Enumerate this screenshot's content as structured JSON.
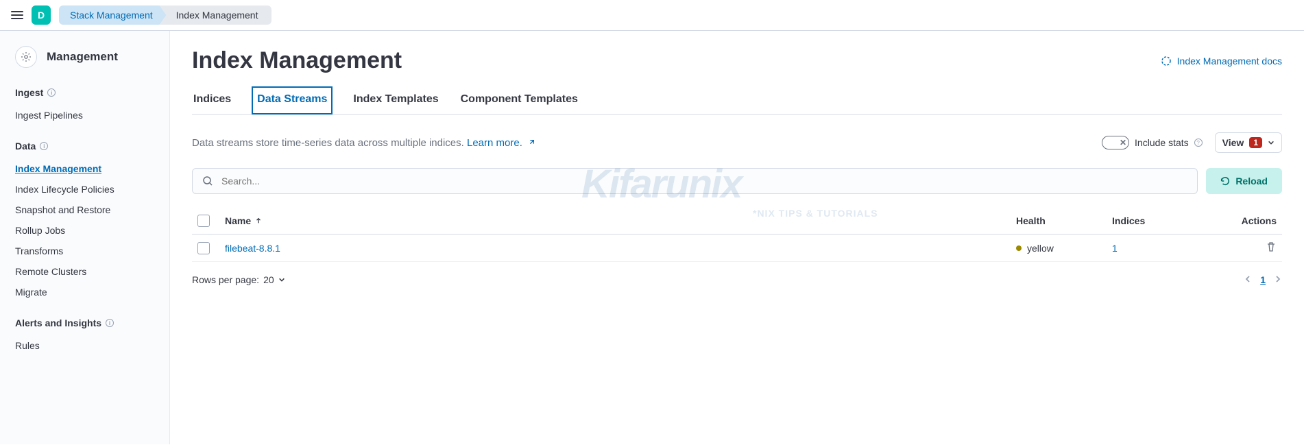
{
  "header": {
    "account_letter": "D",
    "breadcrumbs": [
      {
        "label": "Stack Management"
      },
      {
        "label": "Index Management"
      }
    ]
  },
  "sidebar": {
    "title": "Management",
    "sections": [
      {
        "title": "Ingest",
        "items": [
          {
            "label": "Ingest Pipelines",
            "active": false
          }
        ]
      },
      {
        "title": "Data",
        "items": [
          {
            "label": "Index Management",
            "active": true
          },
          {
            "label": "Index Lifecycle Policies",
            "active": false
          },
          {
            "label": "Snapshot and Restore",
            "active": false
          },
          {
            "label": "Rollup Jobs",
            "active": false
          },
          {
            "label": "Transforms",
            "active": false
          },
          {
            "label": "Remote Clusters",
            "active": false
          },
          {
            "label": "Migrate",
            "active": false
          }
        ]
      },
      {
        "title": "Alerts and Insights",
        "items": [
          {
            "label": "Rules",
            "active": false
          }
        ]
      }
    ]
  },
  "main": {
    "title": "Index Management",
    "docs_link": "Index Management docs",
    "tabs": [
      {
        "label": "Indices",
        "active": false
      },
      {
        "label": "Data Streams",
        "active": true
      },
      {
        "label": "Index Templates",
        "active": false
      },
      {
        "label": "Component Templates",
        "active": false
      }
    ],
    "description": "Data streams store time-series data across multiple indices.",
    "learn_more": "Learn more.",
    "include_stats_label": "Include stats",
    "view_label": "View",
    "view_badge": "1",
    "search_placeholder": "Search...",
    "reload_label": "Reload",
    "columns": {
      "name": "Name",
      "health": "Health",
      "indices": "Indices",
      "actions": "Actions"
    },
    "rows": [
      {
        "name": "filebeat-8.8.1",
        "health": "yellow",
        "indices": "1"
      }
    ],
    "rows_per_page_label": "Rows per page:",
    "rows_per_page_value": "20",
    "current_page": "1"
  },
  "watermark": {
    "text": "Kifarunix",
    "sub": "*NIX TIPS & TUTORIALS"
  }
}
